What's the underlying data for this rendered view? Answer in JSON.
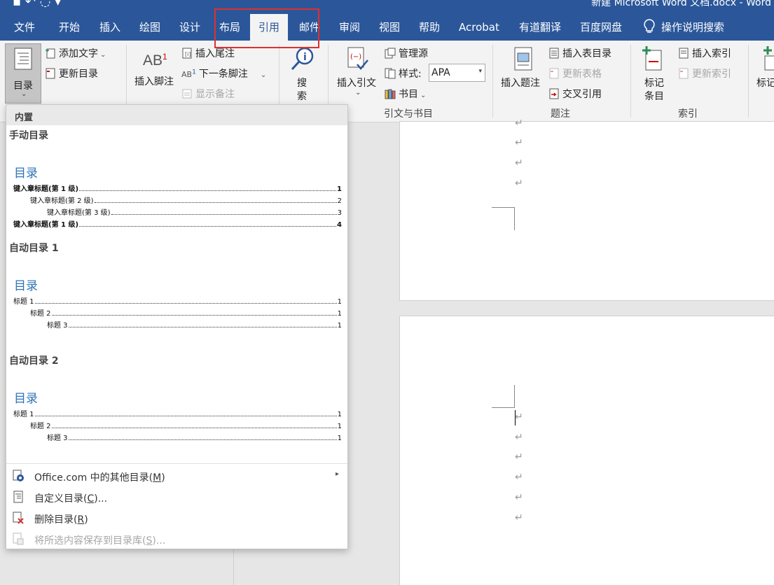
{
  "title_bar": {
    "document_title": "新建 Microsoft Word 文档.docx - Word"
  },
  "tabs": [
    "文件",
    "开始",
    "插入",
    "绘图",
    "设计",
    "布局",
    "引用",
    "邮件",
    "审阅",
    "视图",
    "帮助",
    "Acrobat",
    "有道翻译",
    "百度网盘"
  ],
  "active_tab": "引用",
  "tell_me": "操作说明搜索",
  "ribbon": {
    "toc": {
      "label": "目录",
      "add_text": "添加文字",
      "update_toc": "更新目录"
    },
    "footnotes": {
      "insert_footnote": "插入脚注",
      "insert_endnote": "插入尾注",
      "next_footnote": "下一条脚注",
      "show_notes": "显示备注"
    },
    "research": {
      "search_top": "搜",
      "search_bottom": "索"
    },
    "citations": {
      "insert_citation": "插入引文",
      "manage_sources": "管理源",
      "style_label": "样式:",
      "style_value": "APA",
      "bibliography": "书目",
      "group_label": "引文与书目"
    },
    "captions": {
      "insert_caption": "插入题注",
      "insert_table_of_figures": "插入表目录",
      "update_table": "更新表格",
      "cross_reference": "交叉引用",
      "group_label": "题注"
    },
    "index": {
      "mark_entry_line1": "标记",
      "mark_entry_line2": "条目",
      "insert_index": "插入索引",
      "update_index": "更新索引",
      "group_label": "索引"
    },
    "table_auth": {
      "mark_citation_partial": "标记"
    }
  },
  "toc_dropdown": {
    "section_header": "内置",
    "manual": {
      "title": "手动目录",
      "heading": "目录",
      "lines": [
        {
          "text": "键入章标题(第 1 级)",
          "page": "1"
        },
        {
          "text": "键入章标题(第 2 级)",
          "page": "2"
        },
        {
          "text": "键入章标题(第 3 级)",
          "page": "3"
        },
        {
          "text": "键入章标题(第 1 级)",
          "page": "4"
        }
      ]
    },
    "auto1": {
      "title": "自动目录 1",
      "heading": "目录",
      "lines": [
        {
          "text": "标题 1",
          "page": "1"
        },
        {
          "text": "标题 2",
          "page": "1"
        },
        {
          "text": "标题 3",
          "page": "1"
        }
      ]
    },
    "auto2": {
      "title": "自动目录 2",
      "heading": "目录",
      "lines": [
        {
          "text": "标题 1",
          "page": "1"
        },
        {
          "text": "标题 2",
          "page": "1"
        },
        {
          "text": "标题 3",
          "page": "1"
        }
      ]
    },
    "menu": {
      "office_more_prefix": "Office.com 中的其他目录(",
      "office_more_key": "M",
      "custom_prefix": "自定义目录(",
      "custom_key": "C",
      "custom_suffix": ")...",
      "remove_prefix": "删除目录(",
      "remove_key": "R",
      "save_prefix": "将所选内容保存到目录库(",
      "save_key": "S",
      "save_suffix": ")...",
      "close_paren": ")"
    }
  },
  "colors": {
    "accent": "#2b579a",
    "highlight_box": "#e0302c",
    "toc_heading": "#2e74b5"
  }
}
